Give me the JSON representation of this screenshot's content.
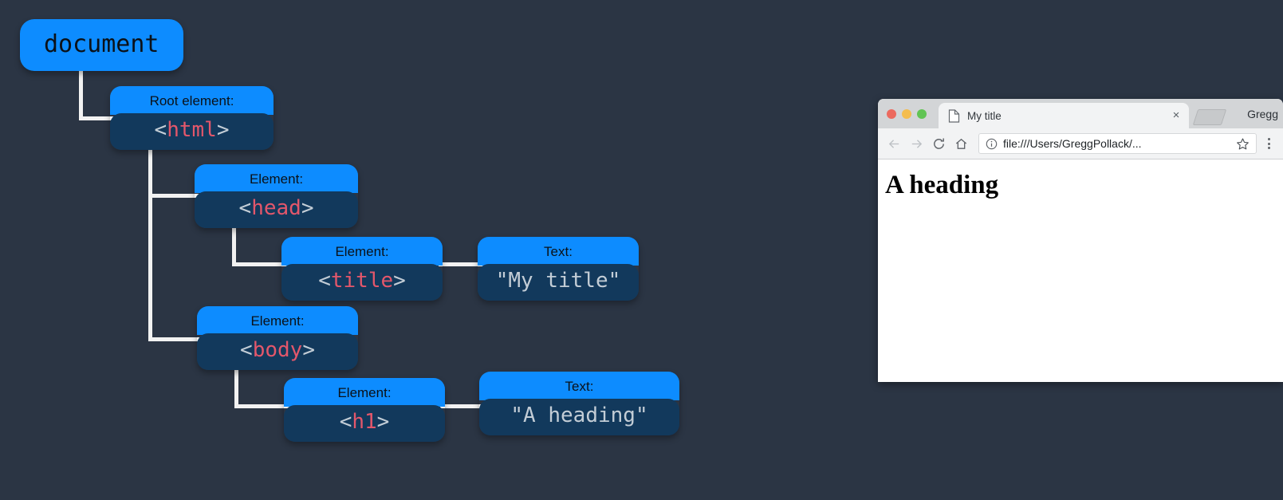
{
  "background_color": "#2b3544",
  "diagram": {
    "title": "DOM tree diagram",
    "root": {
      "label": "document"
    },
    "nodes": [
      {
        "id": "html",
        "kind_label": "Root element:",
        "open_bracket": "<",
        "tag": "html",
        "close_bracket": ">"
      },
      {
        "id": "head",
        "kind_label": "Element:",
        "open_bracket": "<",
        "tag": "head",
        "close_bracket": ">"
      },
      {
        "id": "title",
        "kind_label": "Element:",
        "open_bracket": "<",
        "tag": "title",
        "close_bracket": ">"
      },
      {
        "id": "title-text",
        "kind_label": "Text:",
        "text": "\"My title\""
      },
      {
        "id": "body",
        "kind_label": "Element:",
        "open_bracket": "<",
        "tag": "body",
        "close_bracket": ">"
      },
      {
        "id": "h1",
        "kind_label": "Element:",
        "open_bracket": "<",
        "tag": "h1",
        "close_bracket": ">"
      },
      {
        "id": "h1-text",
        "kind_label": "Text:",
        "text": "\"A heading\""
      }
    ],
    "colors": {
      "header_blue": "#0d8cff",
      "code_panel": "#12395c",
      "tag_red": "#e3576b",
      "bracket_gray": "#c3cdd6",
      "connector": "#f2f2f2"
    }
  },
  "browser": {
    "window_controls": {
      "close": "close-traffic-light",
      "minimize": "minimize-traffic-light",
      "zoom": "zoom-traffic-light"
    },
    "tab": {
      "title": "My title",
      "close_label": "×"
    },
    "new_tab_label": "",
    "profile_name": "Gregg",
    "toolbar": {
      "back": "←",
      "forward": "→",
      "reload": "⟳",
      "home": "⌂",
      "url": "file:///Users/GreggPollack/...",
      "bookmark": "☆",
      "menu": "⋮"
    },
    "page": {
      "heading": "A heading"
    }
  }
}
